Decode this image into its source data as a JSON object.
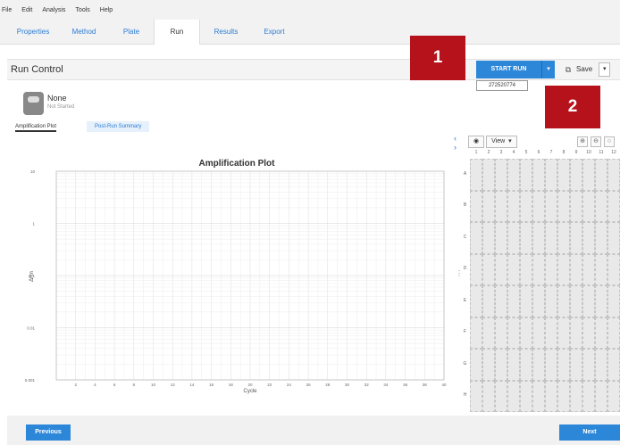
{
  "menu": [
    "File",
    "Edit",
    "Analysis",
    "Tools",
    "Help"
  ],
  "tabs": [
    {
      "label": "Properties",
      "active": false
    },
    {
      "label": "Method",
      "active": false
    },
    {
      "label": "Plate",
      "active": false
    },
    {
      "label": "Run",
      "active": true
    },
    {
      "label": "Results",
      "active": false
    },
    {
      "label": "Export",
      "active": false
    }
  ],
  "run_control": {
    "title": "Run Control",
    "start_run_label": "START RUN",
    "start_run_dropdown_icon": "chevron-down-icon",
    "dropdown_item": "272520774",
    "save_label": "Save",
    "save_icon": "save-icon"
  },
  "callouts": [
    "1",
    "2"
  ],
  "instrument": {
    "name": "None",
    "status": "Not Started"
  },
  "subtabs": [
    "Amplification Plot",
    "Post-Run Summary"
  ],
  "view_panel": {
    "view_label": "View",
    "view_icon": "eye-icon",
    "zoom_in_icon": "zoom-in-icon",
    "zoom_out_icon": "zoom-out-icon"
  },
  "plate": {
    "columns": [
      "1",
      "2",
      "3",
      "4",
      "5",
      "6",
      "7",
      "8",
      "9",
      "10",
      "11",
      "12"
    ],
    "rows": [
      "A",
      "B",
      "C",
      "D",
      "E",
      "F",
      "G",
      "H"
    ]
  },
  "footer": {
    "previous_label": "Previous",
    "next_label": "Next"
  },
  "colors": {
    "accent": "#2d87d9",
    "callout": "#b5121b",
    "link": "#2a7bd4"
  },
  "chart_data": {
    "type": "line",
    "title": "Amplification Plot",
    "xlabel": "Cycle",
    "ylabel": "ΔRn",
    "x_ticks": [
      "2",
      "4",
      "6",
      "8",
      "10",
      "12",
      "14",
      "16",
      "18",
      "20",
      "22",
      "24",
      "26",
      "28",
      "30",
      "32",
      "34",
      "36",
      "38",
      "40"
    ],
    "xlim": [
      0,
      40
    ],
    "y_scale": "log",
    "y_ticks": [
      "10",
      "1",
      "0.1",
      "0.01",
      "0.001"
    ],
    "ylim": [
      0.001,
      10
    ],
    "grid": true,
    "series": []
  }
}
